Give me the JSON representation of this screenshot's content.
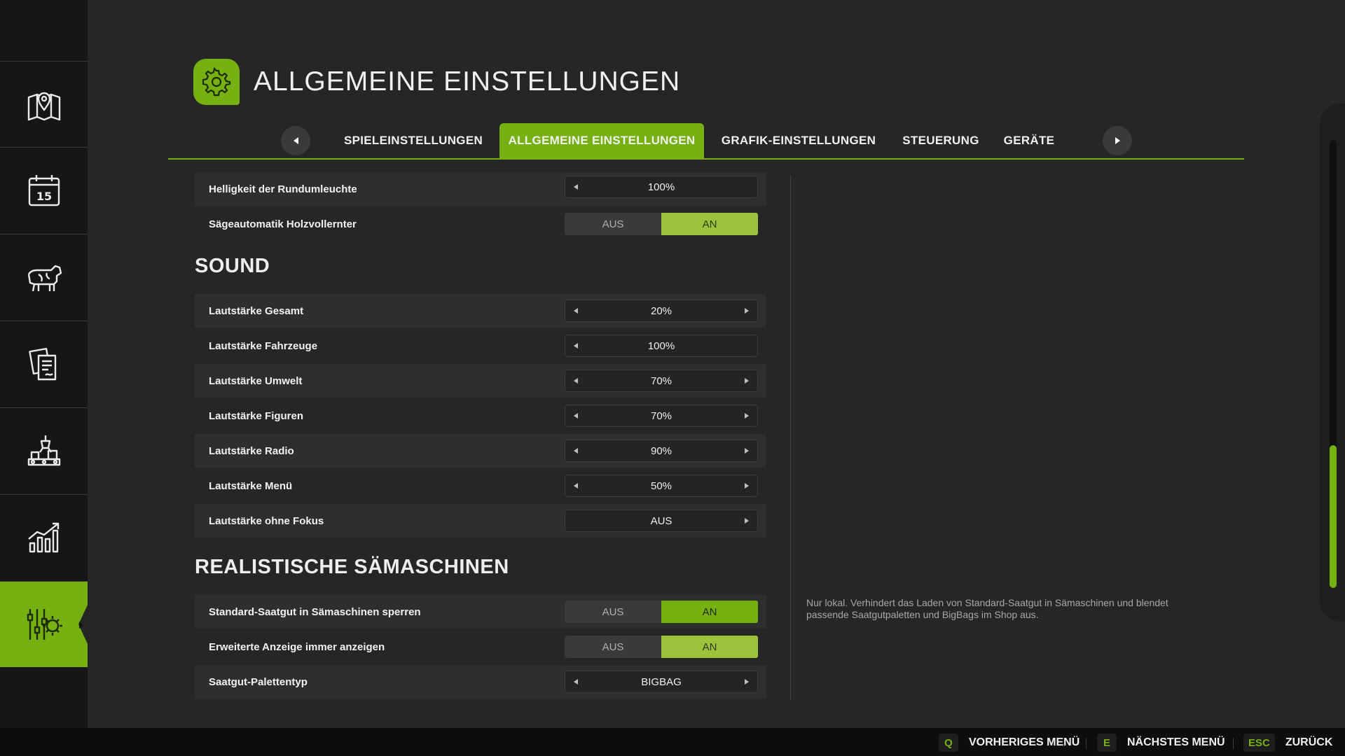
{
  "sidebar": {
    "items": [
      {
        "icon": "map-icon",
        "active": false
      },
      {
        "icon": "calendar-icon",
        "active": false,
        "badge": "15"
      },
      {
        "icon": "cow-icon",
        "active": false
      },
      {
        "icon": "contracts-icon",
        "active": false
      },
      {
        "icon": "production-icon",
        "active": false
      },
      {
        "icon": "statistics-icon",
        "active": false
      },
      {
        "icon": "settings-sliders-icon",
        "active": true
      }
    ]
  },
  "header": {
    "icon": "gear-icon",
    "title": "ALLGEMEINE EINSTELLUNGEN"
  },
  "tabs": {
    "items": [
      {
        "label": "SPIELEINSTELLUNGEN",
        "active": false
      },
      {
        "label": "ALLGEMEINE EINSTELLUNGEN",
        "active": true
      },
      {
        "label": "GRAFIK-EINSTELLUNGEN",
        "active": false
      },
      {
        "label": "STEUERUNG",
        "active": false
      },
      {
        "label": "GERÄTE",
        "active": false
      }
    ]
  },
  "settings": {
    "top": [
      {
        "label": "Helligkeit der Rundumleuchte",
        "value": "100%"
      },
      {
        "label": "Sägeautomatik Holzvollernter",
        "off_label": "AUS",
        "on_label": "AN",
        "value": "AN"
      }
    ],
    "sound": {
      "title": "SOUND",
      "rows": [
        {
          "label": "Lautstärke Gesamt",
          "value": "20%"
        },
        {
          "label": "Lautstärke Fahrzeuge",
          "value": "100%"
        },
        {
          "label": "Lautstärke Umwelt",
          "value": "70%"
        },
        {
          "label": "Lautstärke Figuren",
          "value": "70%"
        },
        {
          "label": "Lautstärke Radio",
          "value": "90%"
        },
        {
          "label": "Lautstärke Menü",
          "value": "50%"
        },
        {
          "label": "Lautstärke ohne Fokus",
          "value": "AUS"
        }
      ]
    },
    "seeders": {
      "title": "REALISTISCHE SÄMASCHINEN",
      "rows": [
        {
          "label": "Standard-Saatgut in Sämaschinen sperren",
          "off_label": "AUS",
          "on_label": "AN",
          "value": "AN"
        },
        {
          "label": "Erweiterte Anzeige immer anzeigen",
          "off_label": "AUS",
          "on_label": "AN",
          "value": "AN"
        },
        {
          "label": "Saatgut-Palettentyp",
          "value": "BIGBAG"
        }
      ]
    }
  },
  "description": "Nur lokal. Verhindert das Laden von Standard-Saatgut in Sämaschinen und blendet passende Saatgutpaletten und BigBags im Shop aus.",
  "footer": {
    "hints": [
      {
        "key": "Q",
        "label": "VORHERIGES MENÜ"
      },
      {
        "key": "E",
        "label": "NÄCHSTES MENÜ"
      },
      {
        "key": "ESC",
        "label": "ZURÜCK"
      }
    ]
  },
  "colors": {
    "accent": "#77b111",
    "background": "#262626",
    "sidebar": "#161616"
  }
}
